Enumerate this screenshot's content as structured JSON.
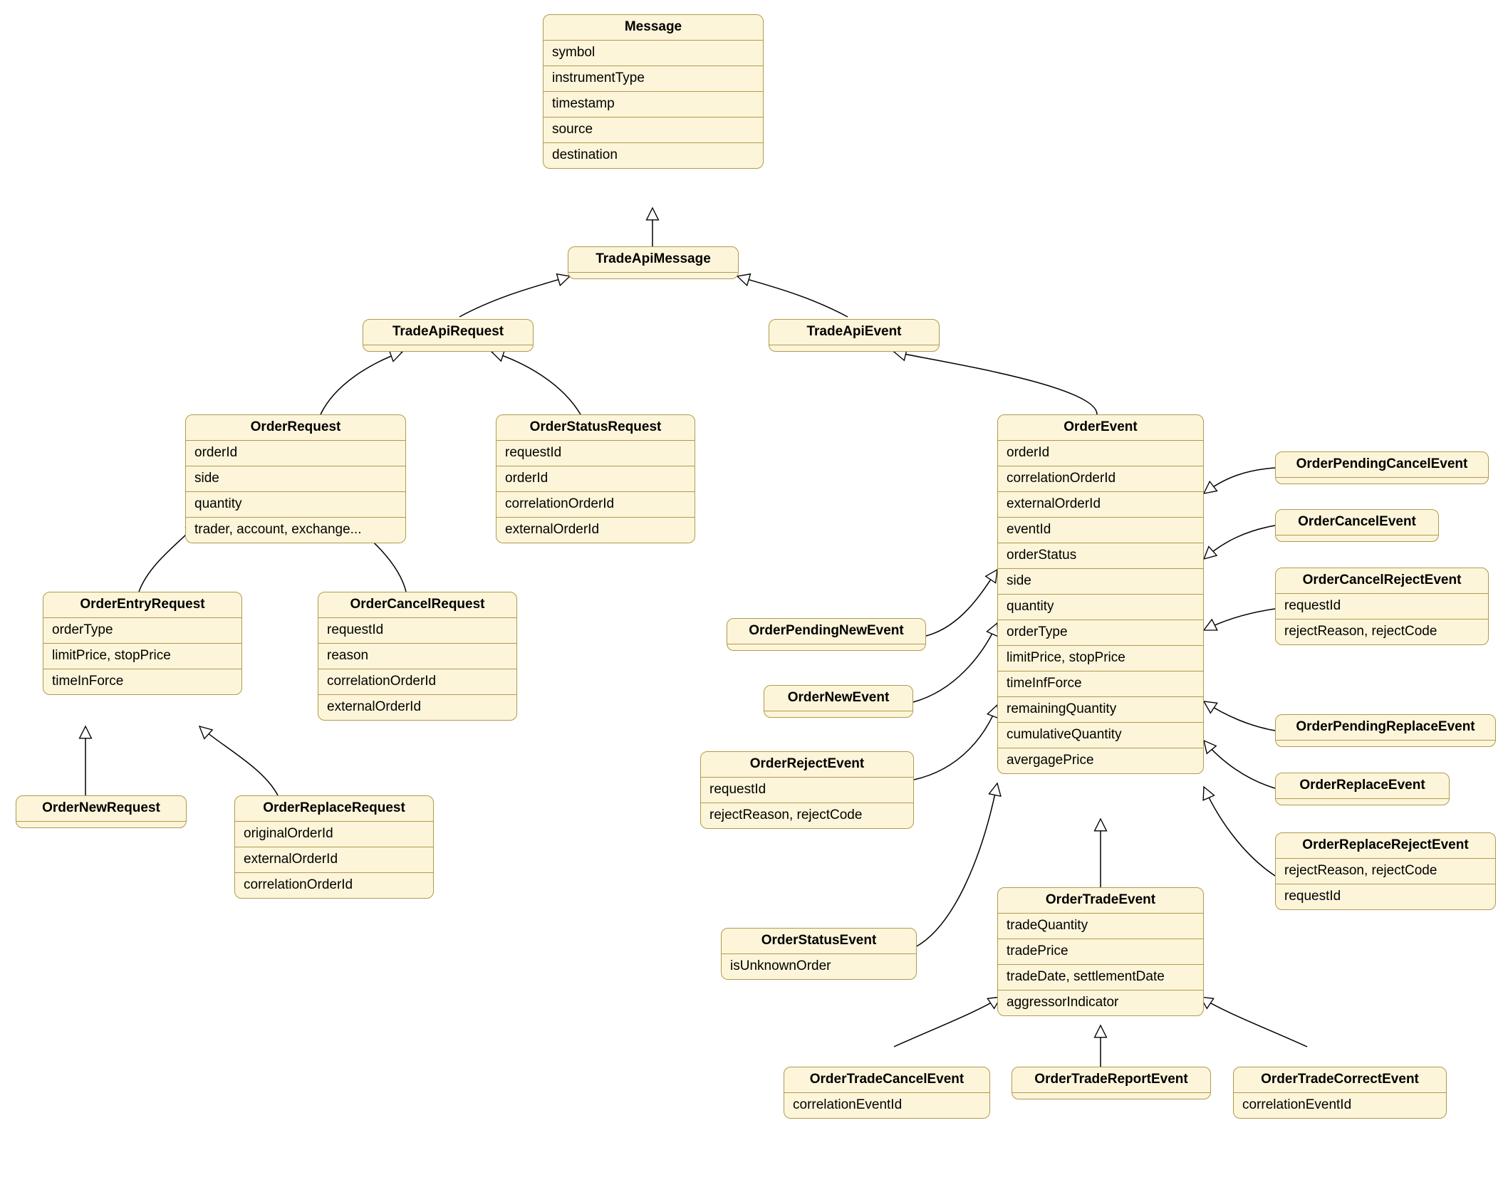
{
  "classes": {
    "Message": {
      "title": "Message",
      "attrs": [
        "symbol",
        "instrumentType",
        "timestamp",
        "source",
        "destination"
      ]
    },
    "TradeApiMessage": {
      "title": "TradeApiMessage",
      "attrs": []
    },
    "TradeApiRequest": {
      "title": "TradeApiRequest",
      "attrs": []
    },
    "TradeApiEvent": {
      "title": "TradeApiEvent",
      "attrs": []
    },
    "OrderRequest": {
      "title": "OrderRequest",
      "attrs": [
        "orderId",
        "side",
        "quantity",
        "trader, account, exchange..."
      ]
    },
    "OrderStatusRequest": {
      "title": "OrderStatusRequest",
      "attrs": [
        "requestId",
        "orderId",
        "correlationOrderId",
        "externalOrderId"
      ]
    },
    "OrderEvent": {
      "title": "OrderEvent",
      "attrs": [
        "orderId",
        "correlationOrderId",
        "externalOrderId",
        "eventId",
        "orderStatus",
        "side",
        "quantity",
        "orderType",
        "limitPrice, stopPrice",
        "timeInfForce",
        "remainingQuantity",
        "cumulativeQuantity",
        "avergagePrice"
      ]
    },
    "OrderEntryRequest": {
      "title": "OrderEntryRequest",
      "attrs": [
        "orderType",
        "limitPrice, stopPrice",
        "timeInForce"
      ]
    },
    "OrderCancelRequest": {
      "title": "OrderCancelRequest",
      "attrs": [
        "requestId",
        "reason",
        "correlationOrderId",
        "externalOrderId"
      ]
    },
    "OrderNewRequest": {
      "title": "OrderNewRequest",
      "attrs": []
    },
    "OrderReplaceRequest": {
      "title": "OrderReplaceRequest",
      "attrs": [
        "originalOrderId",
        "externalOrderId",
        "correlationOrderId"
      ]
    },
    "OrderPendingNewEvent": {
      "title": "OrderPendingNewEvent",
      "attrs": []
    },
    "OrderNewEvent": {
      "title": "OrderNewEvent",
      "attrs": []
    },
    "OrderRejectEvent": {
      "title": "OrderRejectEvent",
      "attrs": [
        "requestId",
        "rejectReason, rejectCode"
      ]
    },
    "OrderStatusEvent": {
      "title": "OrderStatusEvent",
      "attrs": [
        "isUnknownOrder"
      ]
    },
    "OrderTradeEvent": {
      "title": "OrderTradeEvent",
      "attrs": [
        "tradeQuantity",
        "tradePrice",
        "tradeDate, settlementDate",
        "aggressorIndicator"
      ]
    },
    "OrderTradeCancelEvent": {
      "title": "OrderTradeCancelEvent",
      "attrs": [
        "correlationEventId"
      ]
    },
    "OrderTradeReportEvent": {
      "title": "OrderTradeReportEvent",
      "attrs": []
    },
    "OrderTradeCorrectEvent": {
      "title": "OrderTradeCorrectEvent",
      "attrs": [
        "correlationEventId"
      ]
    },
    "OrderPendingCancelEvent": {
      "title": "OrderPendingCancelEvent",
      "attrs": []
    },
    "OrderCancelEvent": {
      "title": "OrderCancelEvent",
      "attrs": []
    },
    "OrderCancelRejectEvent": {
      "title": "OrderCancelRejectEvent",
      "attrs": [
        "requestId",
        "rejectReason, rejectCode"
      ]
    },
    "OrderPendingReplaceEvent": {
      "title": "OrderPendingReplaceEvent",
      "attrs": []
    },
    "OrderReplaceEvent": {
      "title": "OrderReplaceEvent",
      "attrs": []
    },
    "OrderReplaceRejectEvent": {
      "title": "OrderReplaceRejectEvent",
      "attrs": [
        "rejectReason, rejectCode",
        "requestId"
      ]
    }
  }
}
